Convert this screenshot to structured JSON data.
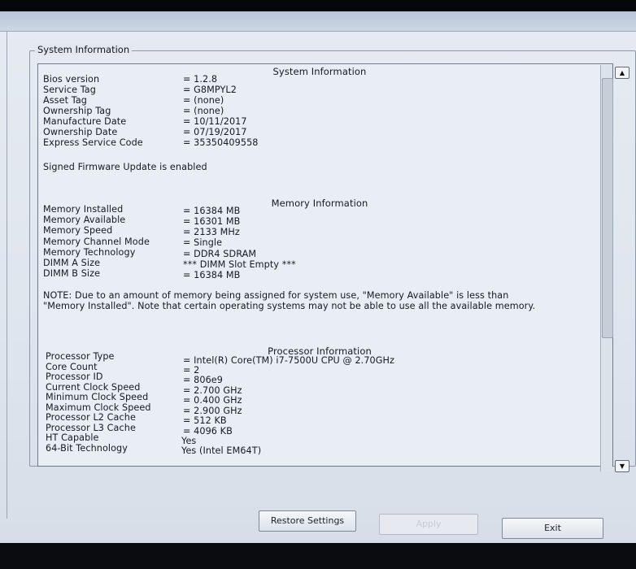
{
  "group_title": "System Information",
  "system": {
    "heading": "System Information",
    "rows": [
      {
        "label": "Bios version",
        "value": "= 1.2.8"
      },
      {
        "label": "Service Tag",
        "value": "= G8MPYL2"
      },
      {
        "label": "Asset Tag",
        "value": "= (none)"
      },
      {
        "label": "Ownership Tag",
        "value": "= (none)"
      },
      {
        "label": "Manufacture Date",
        "value": "= 10/11/2017"
      },
      {
        "label": "Ownership Date",
        "value": "= 07/19/2017"
      },
      {
        "label": "Express Service Code",
        "value": "= 35350409558"
      }
    ],
    "firmware_note": "Signed Firmware Update is enabled"
  },
  "memory": {
    "heading": "Memory Information",
    "rows": [
      {
        "label": "Memory Installed",
        "value": "= 16384 MB"
      },
      {
        "label": "Memory Available",
        "value": "= 16301 MB"
      },
      {
        "label": "Memory Speed",
        "value": "= 2133 MHz"
      },
      {
        "label": "Memory Channel Mode",
        "value": "= Single"
      },
      {
        "label": "Memory Technology",
        "value": "= DDR4 SDRAM"
      },
      {
        "label": "DIMM A Size",
        "value": "*** DIMM Slot Empty ***"
      },
      {
        "label": "DIMM B Size",
        "value": "= 16384 MB"
      }
    ],
    "note": "NOTE: Due to an amount of memory being assigned for system use, \"Memory Available\" is less than \"Memory Installed\". Note that certain operating systems may not be able to use all the available memory."
  },
  "processor": {
    "heading": "Processor Information",
    "rows": [
      {
        "label": "Processor Type",
        "value": "= Intel(R) Core(TM) i7-7500U CPU @ 2.70GHz"
      },
      {
        "label": "Core Count",
        "value": "= 2"
      },
      {
        "label": "Processor ID",
        "value": "= 806e9"
      },
      {
        "label": "Current Clock Speed",
        "value": "= 2.700 GHz"
      },
      {
        "label": "Minimum Clock Speed",
        "value": "= 0.400 GHz"
      },
      {
        "label": "Maximum Clock Speed",
        "value": "= 2.900 GHz"
      },
      {
        "label": "Processor L2 Cache",
        "value": "= 512 KB"
      },
      {
        "label": "Processor L3 Cache",
        "value": "= 4096 KB"
      },
      {
        "label": "HT Capable",
        "value": "Yes"
      },
      {
        "label": "64-Bit Technology",
        "value": "Yes (Intel EM64T)"
      }
    ]
  },
  "buttons": {
    "restore": "Restore Settings",
    "apply": "Apply",
    "exit": "Exit"
  },
  "icons": {
    "scroll_up": "triangle-up",
    "scroll_down": "triangle-down"
  }
}
